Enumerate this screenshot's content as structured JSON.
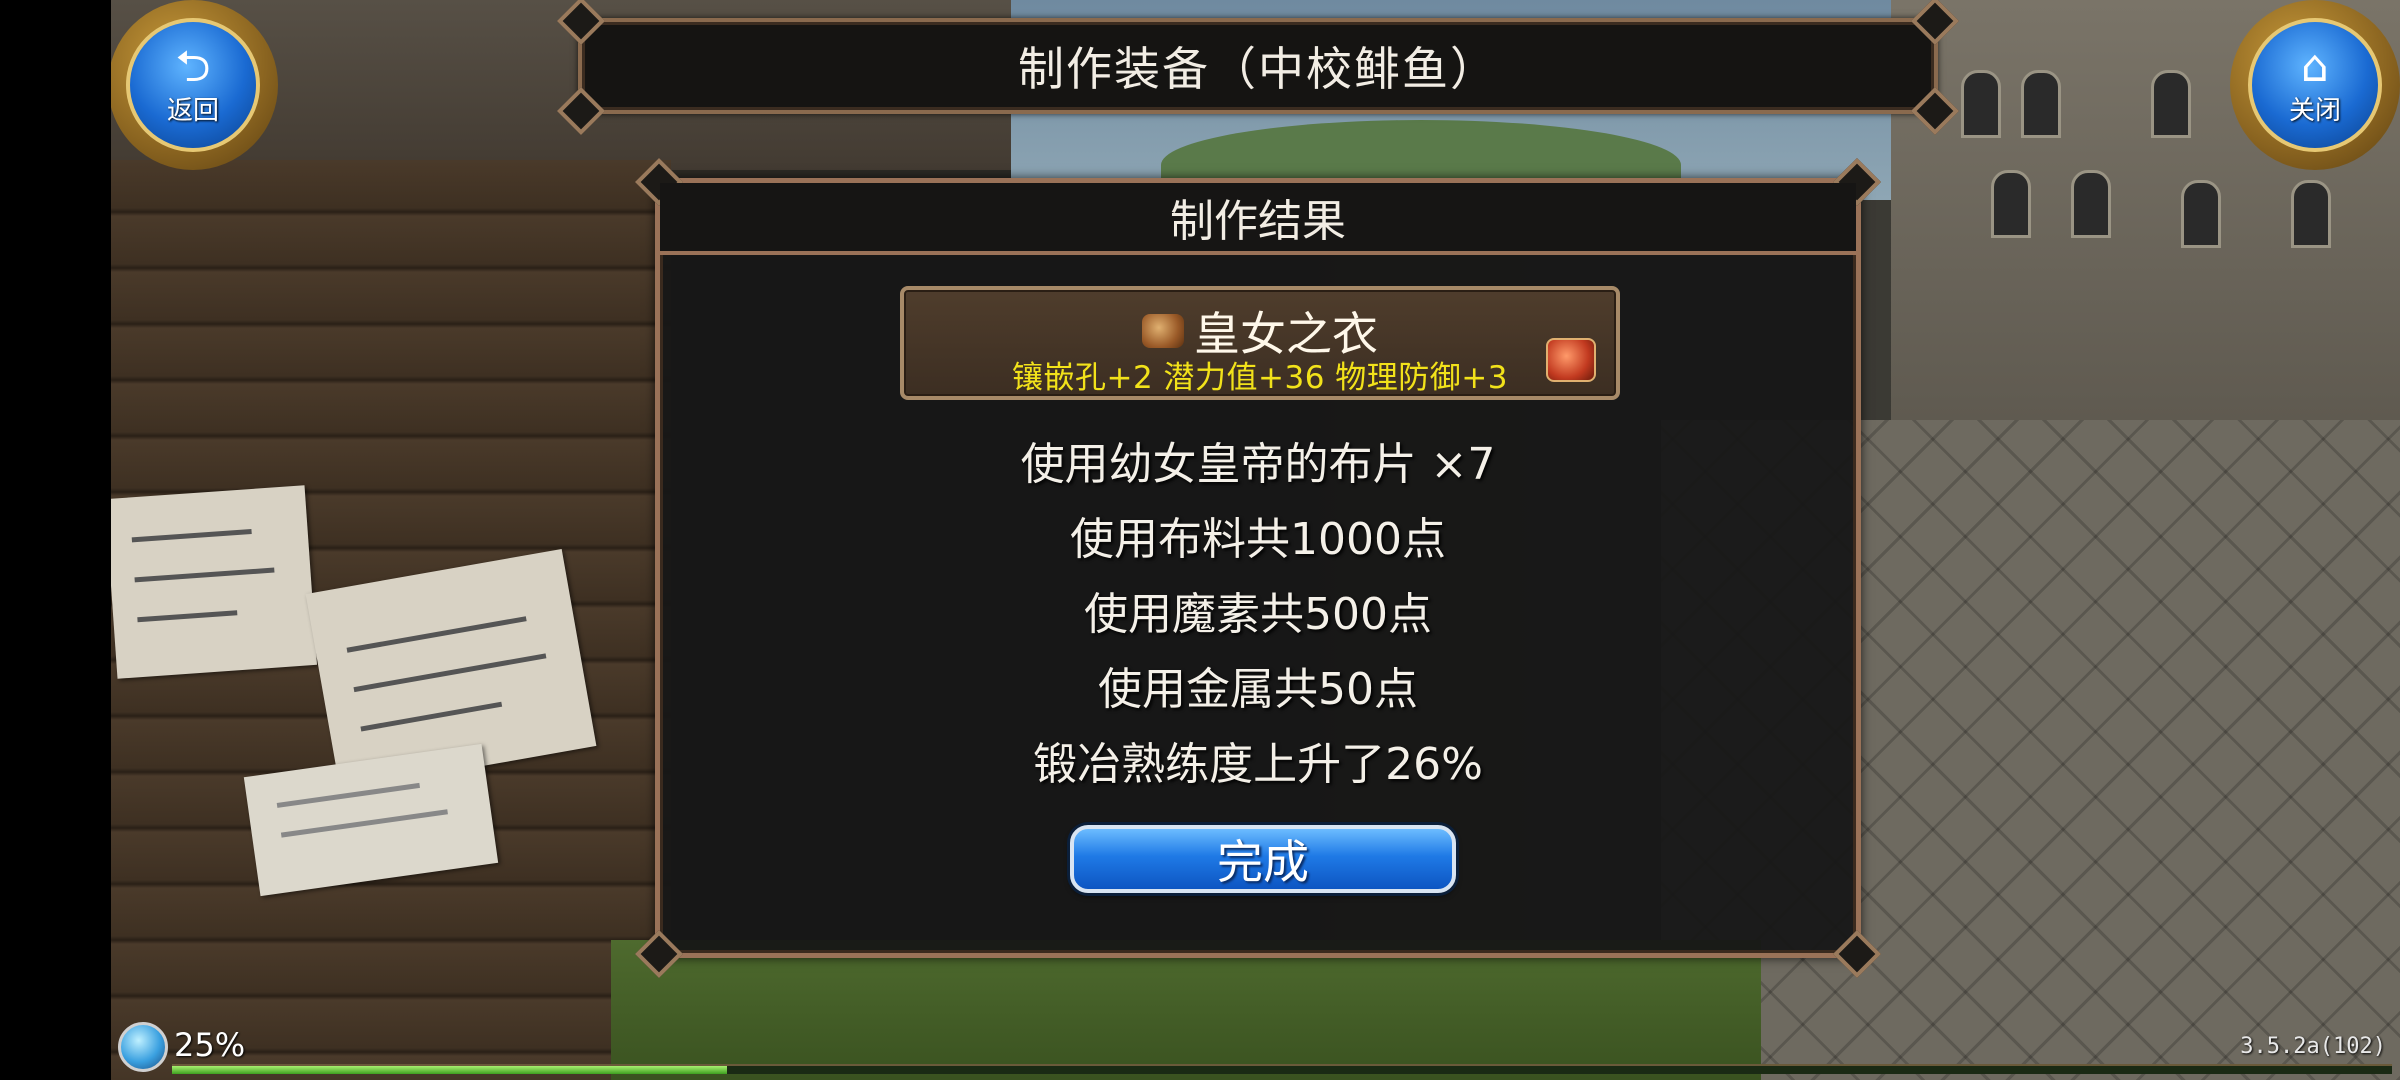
{
  "header": {
    "title": "制作装备（中校鲱鱼）",
    "back_button_label": "返回",
    "close_button_label": "关闭"
  },
  "panel": {
    "title": "制作结果",
    "item": {
      "name": "皇女之衣",
      "stats": "镶嵌孔+2  潜力值+36  物理防御+3"
    },
    "lines": [
      "使用幼女皇帝的布片  ×7",
      "使用布料共1000点",
      "使用魔素共500点",
      "使用金属共50点",
      "锻冶熟练度上升了26%"
    ],
    "done_button_label": "完成"
  },
  "status": {
    "progress_text": "25%",
    "progress_value": 0.25,
    "version": "3.5.2a(102)"
  },
  "icons": {
    "back": "back-arrow-icon",
    "close": "home-icon",
    "item": "armor-icon",
    "chest": "treasure-chest-icon",
    "loading": "loading-orb-icon"
  },
  "colors": {
    "stat_text": "#f2e21a",
    "button_blue": "#1f7ae6",
    "frame_gold": "#9a7258"
  }
}
